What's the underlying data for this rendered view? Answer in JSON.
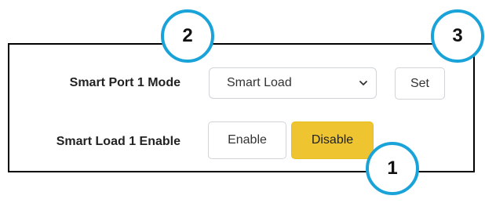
{
  "rows": {
    "mode": {
      "label": "Smart Port 1 Mode",
      "select_value": "Smart Load",
      "set_label": "Set"
    },
    "enable": {
      "label": "Smart Load 1 Enable",
      "enable_label": "Enable",
      "disable_label": "Disable"
    }
  },
  "callouts": {
    "one": "1",
    "two": "2",
    "three": "3"
  },
  "colors": {
    "callout_ring": "#1aa3d9",
    "disable_button": "#eec530",
    "panel_border": "#000000"
  },
  "icons": {
    "select_arrow": "chevron-down-icon"
  }
}
